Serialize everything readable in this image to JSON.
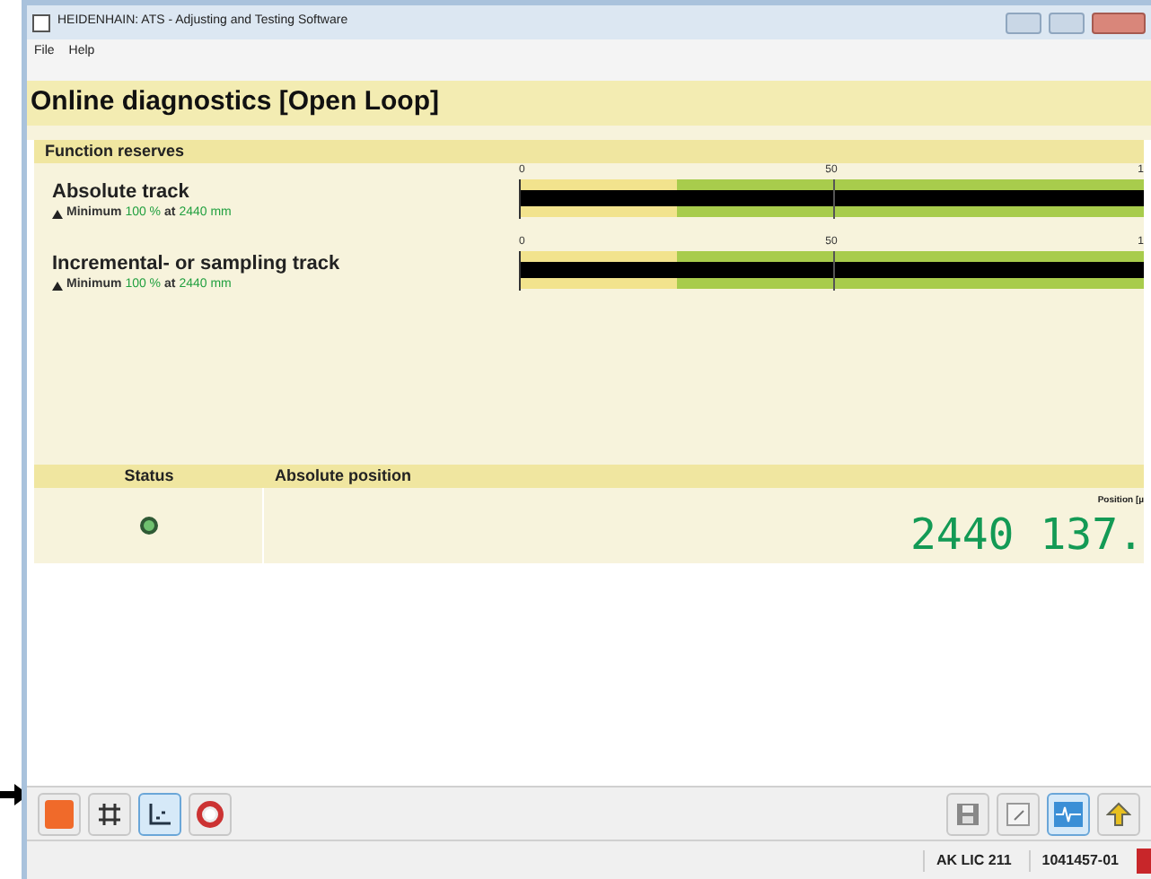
{
  "window": {
    "title": "HEIDENHAIN: ATS - Adjusting and Testing Software"
  },
  "menu": [
    "File",
    "Help"
  ],
  "heading": "Online diagnostics [Open Loop]",
  "function_reserves": {
    "title": "Function reserves",
    "tracks": [
      {
        "name": "Absolute track",
        "parts": [
          "Minimum",
          "100 %",
          "at",
          "2440 mm"
        ],
        "ticks": [
          "0",
          "50",
          "1"
        ],
        "level": 1
      },
      {
        "name": "Incremental- or sampling track",
        "parts": [
          "Minimum",
          "100 %",
          "at",
          "2440 mm"
        ],
        "ticks": [
          "0",
          "50",
          "1"
        ],
        "level": 1
      }
    ]
  },
  "position_table": {
    "columns": [
      "Status",
      "Absolute position"
    ],
    "status_ok": true,
    "position_label": "Position [µ",
    "reading": "2440 137."
  },
  "toolbar": {
    "left": [
      {
        "kind": "stop",
        "selected": false
      },
      {
        "kind": "grid",
        "selected": false
      },
      {
        "kind": "axes",
        "selected": true
      },
      {
        "kind": "magnet",
        "selected": false
      }
    ],
    "right": [
      {
        "kind": "save",
        "selected": false
      },
      {
        "kind": "edit",
        "selected": false
      },
      {
        "kind": "signal",
        "selected": true
      },
      {
        "kind": "up",
        "selected": false
      }
    ]
  },
  "status_bar": [
    "AK LIC 211",
    "1041457-01"
  ]
}
